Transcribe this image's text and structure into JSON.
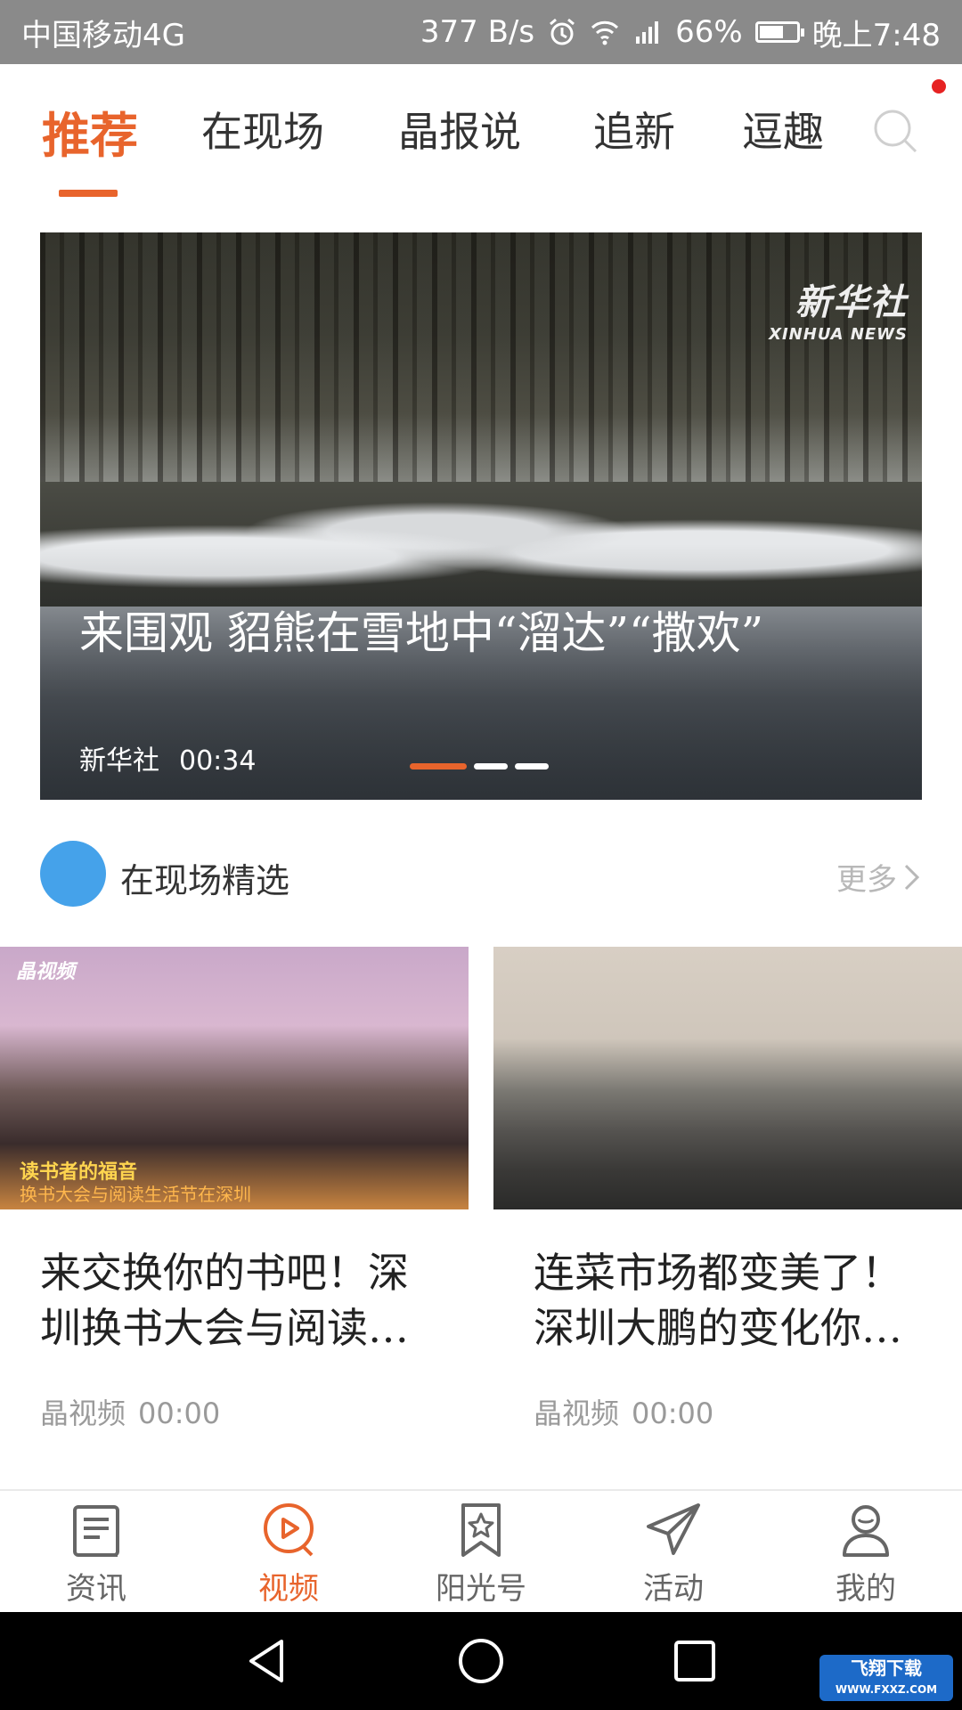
{
  "status_bar": {
    "carrier": "中国移动4G",
    "speed": "377 B/s",
    "battery": "66%",
    "time": "晚上7:48"
  },
  "tabs": [
    {
      "label": "推荐",
      "active": true
    },
    {
      "label": "在现场",
      "active": false
    },
    {
      "label": "晶报说",
      "active": false
    },
    {
      "label": "追新",
      "active": false
    },
    {
      "label": "逗趣",
      "active": false
    }
  ],
  "hero": {
    "logo_cn": "新华社",
    "logo_en": "XINHUA NEWS",
    "title": "来围观  貂熊在雪地中“溜达”“撒欢”",
    "source": "新华社",
    "duration": "00:34",
    "slides": 3,
    "active_slide": 1
  },
  "section": {
    "title": "在现场精选",
    "more": "更多"
  },
  "cards": [
    {
      "thumb_tag": "晶视频",
      "thumb_banner": "读书者的福音",
      "thumb_banner2": "换书大会与阅读生活节在深圳",
      "title": "来交换你的书吧！深圳换书大会与阅读…",
      "source": "晶视频",
      "duration": "00:00"
    },
    {
      "title": "连菜市场都变美了！深圳大鹏的变化你…",
      "source": "晶视频",
      "duration": "00:00"
    }
  ],
  "bottom_nav": [
    {
      "label": "资讯",
      "icon": "news-icon",
      "active": false
    },
    {
      "label": "视频",
      "icon": "video-play-icon",
      "active": true
    },
    {
      "label": "阳光号",
      "icon": "bookmark-star-icon",
      "active": false
    },
    {
      "label": "活动",
      "icon": "paper-plane-icon",
      "active": false
    },
    {
      "label": "我的",
      "icon": "user-icon",
      "active": false
    }
  ],
  "watermark": {
    "text": "飞翔下载",
    "url": "WWW.FXXZ.COM"
  },
  "colors": {
    "accent": "#e8642c",
    "section_dot": "#45a2ea",
    "notify": "#e62222"
  }
}
